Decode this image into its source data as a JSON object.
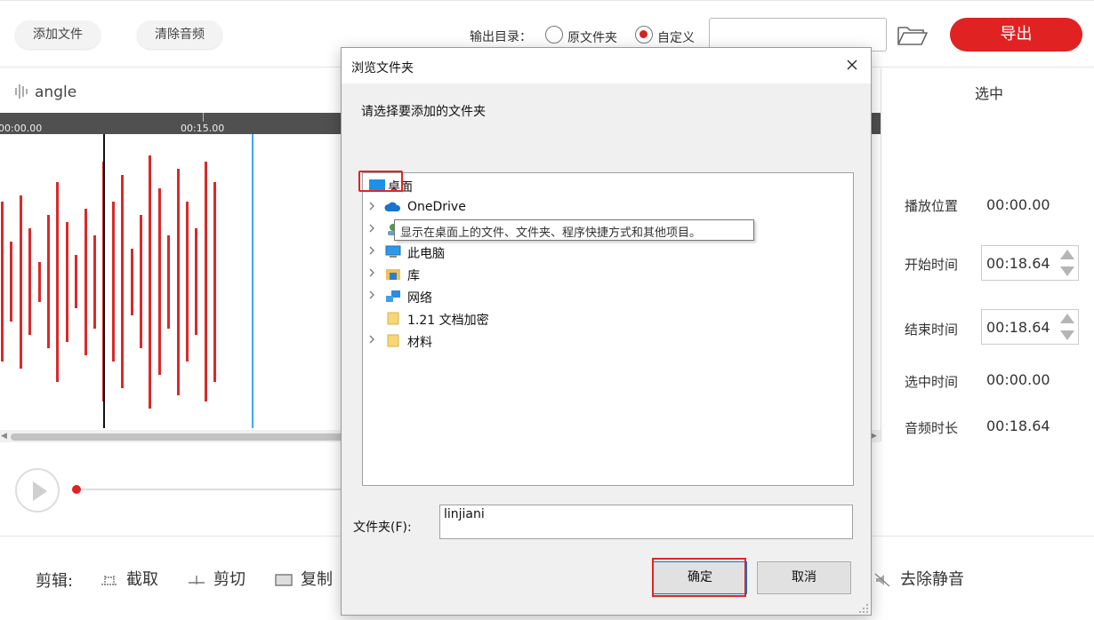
{
  "toolbar": {
    "add_file": "添加文件",
    "clear_audio": "清除音频",
    "output_dir_label": "输出目录：",
    "radio_original": "原文件夹",
    "radio_custom": "自定义",
    "path_value": "",
    "export": "导出"
  },
  "track": {
    "name": "angle",
    "time_start": "00:00.00",
    "time_mid": "00:15.00"
  },
  "waveform": {
    "bar_heights": [
      0.6,
      0.3,
      0.65,
      0.4,
      0.15,
      0.5,
      0.75,
      0.45,
      0.2,
      0.55,
      0.35,
      0.9,
      0.6,
      0.8,
      0.25,
      0.5,
      0.95,
      0.7,
      0.35,
      0.85,
      0.6,
      0.4,
      0.9,
      0.75
    ],
    "color": "#d92a2a"
  },
  "properties": {
    "title": "选中",
    "play_pos_label": "播放位置",
    "play_pos_value": "00:00.00",
    "start_label": "开始时间",
    "start_value": "00:18.64",
    "end_label": "结束时间",
    "end_value": "00:18.64",
    "sel_label": "选中时间",
    "sel_value": "00:00.00",
    "duration_label": "音频时长",
    "duration_value": "00:18.64"
  },
  "edit": {
    "label": "剪辑:",
    "trim": "截取",
    "cut": "剪切",
    "copy": "复制",
    "remove_silence": "去除静音"
  },
  "dialog": {
    "title": "浏览文件夹",
    "prompt": "请选择要添加的文件夹",
    "tree": [
      {
        "label": "桌面",
        "icon": "desktop-icon",
        "expandable": false,
        "bold": true
      },
      {
        "label": "OneDrive",
        "icon": "cloud-icon",
        "expandable": true
      },
      {
        "label": "",
        "icon": "user-icon",
        "expandable": true
      },
      {
        "label": "此电脑",
        "icon": "computer-icon",
        "expandable": true
      },
      {
        "label": "库",
        "icon": "library-icon",
        "expandable": true
      },
      {
        "label": "网络",
        "icon": "network-icon",
        "expandable": true
      },
      {
        "label": "1.21 文档加密",
        "icon": "folder-icon",
        "expandable": false
      },
      {
        "label": "材料",
        "icon": "folder-icon",
        "expandable": true
      }
    ],
    "tooltip": "显示在桌面上的文件、文件夹、程序快捷方式和其他项目。",
    "folder_label": "文件夹(F):",
    "folder_value": "linjiani",
    "ok": "确定",
    "cancel": "取消"
  }
}
